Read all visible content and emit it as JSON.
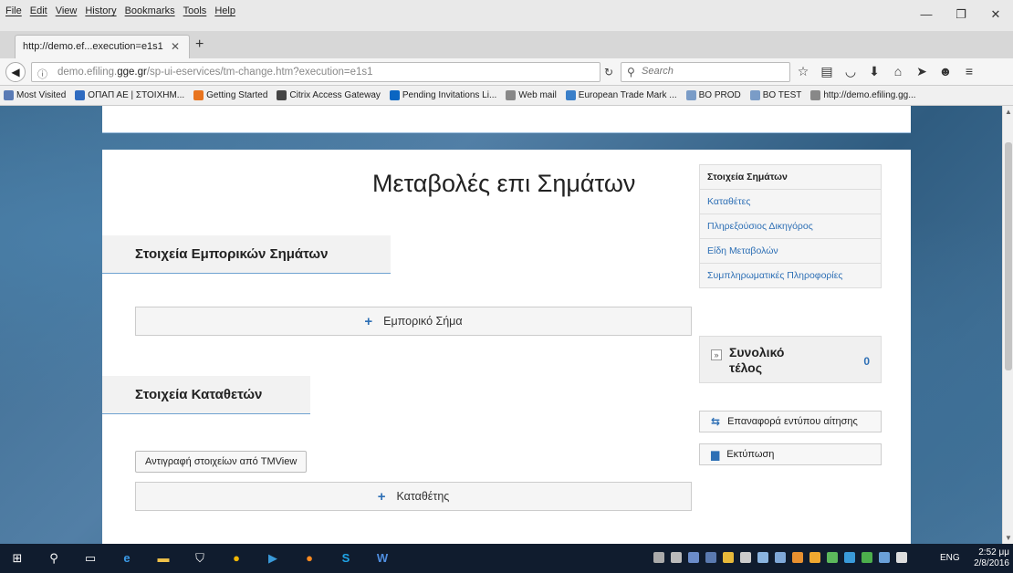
{
  "browser": {
    "menu": [
      "File",
      "Edit",
      "View",
      "History",
      "Bookmarks",
      "Tools",
      "Help"
    ],
    "window_controls": [
      "—",
      "❐",
      "✕"
    ],
    "tab_title": "http://demo.ef...execution=e1s1",
    "url_prefix": "demo.efiling.",
    "url_domain": "gge.gr",
    "url_path": "/sp-ui-eservices/tm-change.htm?execution=e1s1",
    "search_placeholder": "Search",
    "bookmarks": [
      {
        "label": "Most Visited",
        "color": "#5a7bb5"
      },
      {
        "label": "ΟΠΑΠ ΑΕ | ΣΤΟΙΧΗΜ...",
        "color": "#2f6bc0"
      },
      {
        "label": "Getting Started",
        "color": "#e8741f"
      },
      {
        "label": "Citrix Access Gateway",
        "color": "#444444"
      },
      {
        "label": "Pending Invitations Li...",
        "color": "#0a66c2"
      },
      {
        "label": "Web mail",
        "color": "#888888"
      },
      {
        "label": "European Trade Mark ...",
        "color": "#3a7fc9"
      },
      {
        "label": "BO PROD",
        "color": "#7a9cc7"
      },
      {
        "label": "BO TEST",
        "color": "#7a9cc7"
      },
      {
        "label": "http://demo.efiling.gg...",
        "color": "#888888"
      }
    ]
  },
  "page": {
    "title": "Μεταβολές επι Σημάτων",
    "section_trademarks": "Στοιχεία Εμπορικών Σημάτων",
    "add_trademark": "Εμπορικό Σήμα",
    "section_applicants": "Στοιχεία Καταθετών",
    "copy_tmview": "Αντιγραφή στοιχείων από TMView",
    "add_applicant": "Καταθέτης"
  },
  "sidenav": [
    "Στοιχεία Σημάτων",
    "Καταθέτες",
    "Πληρεξούσιος Δικηγόρος",
    "Είδη Μεταβολών",
    "Συμπληρωματικές Πληροφορίες"
  ],
  "total": {
    "label": "Συνολικό τέλος",
    "value": "0"
  },
  "actions": {
    "reset": "Επαναφορά εντύπου αίτησης",
    "print": "Εκτύπωση"
  },
  "taskbar": {
    "lang": "ENG",
    "time": "2:52 μμ",
    "date": "2/8/2016"
  },
  "colors": {
    "accent": "#2d6fb5",
    "taskbar": "#101c2e"
  }
}
